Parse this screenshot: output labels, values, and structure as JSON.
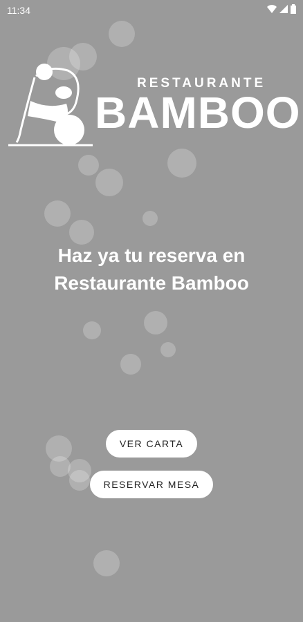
{
  "status_bar": {
    "time": "11:34"
  },
  "logo": {
    "small_text": "RESTAURANTE",
    "big_text": "BAMBOO"
  },
  "headline": {
    "line1": "Haz ya tu reserva en",
    "line2": "Restaurante Bamboo"
  },
  "buttons": {
    "menu_label": "VER CARTA",
    "reserve_label": "RESERVAR MESA"
  },
  "colors": {
    "background": "#9a9a9a",
    "text": "#ffffff",
    "button_bg": "#ffffff"
  }
}
